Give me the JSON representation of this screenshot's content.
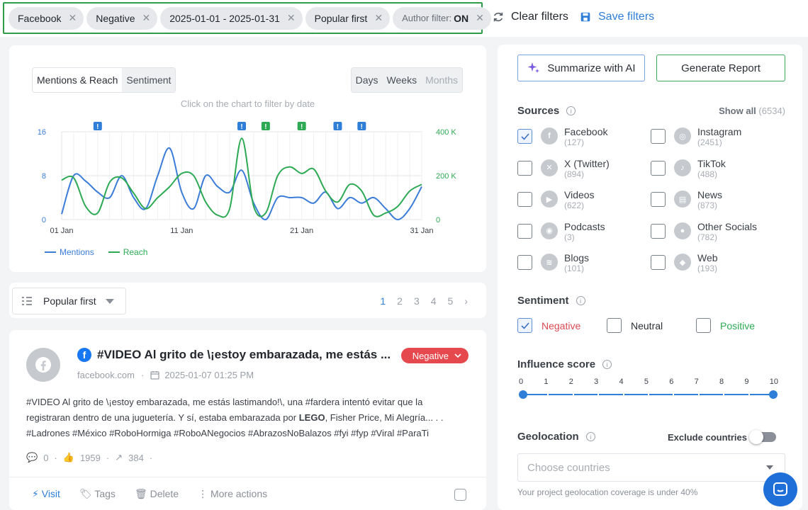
{
  "filters": {
    "chips": [
      {
        "label": "Facebook"
      },
      {
        "label": "Negative"
      },
      {
        "label": "2025-01-01 - 2025-01-31"
      },
      {
        "label": "Popular first"
      }
    ],
    "author_filter": {
      "label": "Author filter:",
      "value": "ON"
    },
    "clear_label": "Clear filters",
    "save_label": "Save filters"
  },
  "chart_panel": {
    "tabs_left": [
      "Mentions & Reach",
      "Sentiment"
    ],
    "tabs_right": [
      "Days",
      "Weeks",
      "Months"
    ],
    "hint": "Click on the chart to filter by date"
  },
  "chart_data": {
    "type": "line",
    "x": [
      "01 Jan",
      "02 Jan",
      "03 Jan",
      "04 Jan",
      "05 Jan",
      "06 Jan",
      "07 Jan",
      "08 Jan",
      "09 Jan",
      "10 Jan",
      "11 Jan",
      "12 Jan",
      "13 Jan",
      "14 Jan",
      "15 Jan",
      "16 Jan",
      "17 Jan",
      "18 Jan",
      "19 Jan",
      "20 Jan",
      "21 Jan",
      "22 Jan",
      "23 Jan",
      "24 Jan",
      "25 Jan",
      "26 Jan",
      "27 Jan",
      "28 Jan",
      "29 Jan",
      "30 Jan",
      "31 Jan"
    ],
    "xticks": [
      "01 Jan",
      "11 Jan",
      "21 Jan",
      "31 Jan"
    ],
    "left_axis": {
      "ticks": [
        "0",
        "8",
        "16"
      ],
      "range": [
        0,
        16
      ]
    },
    "right_axis": {
      "ticks": [
        "0",
        "200 K",
        "400 K"
      ],
      "range": [
        0,
        400000
      ]
    },
    "series": [
      {
        "name": "Mentions",
        "color": "#3b7dd8",
        "axis": "left",
        "values": [
          1,
          8,
          7,
          5,
          4,
          8,
          4,
          2,
          8,
          13,
          5,
          2,
          8,
          6,
          5,
          9,
          3,
          0,
          4,
          4,
          4,
          3,
          5,
          2,
          4,
          3,
          4,
          2,
          0,
          2,
          6
        ]
      },
      {
        "name": "Reach",
        "color": "#2eaa55",
        "axis": "right",
        "values": [
          180000,
          190000,
          60000,
          30000,
          170000,
          190000,
          120000,
          50000,
          100000,
          150000,
          210000,
          200000,
          80000,
          20000,
          50000,
          370000,
          60000,
          30000,
          200000,
          240000,
          210000,
          230000,
          130000,
          80000,
          160000,
          130000,
          20000,
          30000,
          60000,
          130000,
          160000
        ]
      }
    ],
    "markers_x": [
      "04 Jan",
      "16 Jan",
      "18 Jan",
      "21 Jan",
      "24 Jan",
      "26 Jan"
    ],
    "marker_colors": [
      "#2f7fd8",
      "#2f7fd8",
      "#2eaa55",
      "#2eaa55",
      "#2f7fd8",
      "#2f7fd8"
    ],
    "legend": [
      "Mentions",
      "Reach"
    ]
  },
  "sort": {
    "label": "Popular first",
    "pages": [
      "1",
      "2",
      "3",
      "4",
      "5"
    ],
    "current": "1"
  },
  "post": {
    "title": "#VIDEO Al grito de \\¡estoy embarazada, me estás ...",
    "sentiment": "Negative",
    "domain": "facebook.com",
    "date": "2025-01-07 01:25 PM",
    "body_1": "#VIDEO Al grito de \\¡estoy embarazada, me estás lastimando!\\, una #fardera intentó evitar que la",
    "body_2a": "registraran dentro de una juguetería. Y sí, estaba embarazada por ",
    "body_2b": "LEGO",
    "body_2c": ", Fisher Price, Mi Alegría... . .",
    "body_3": "#Ladrones #México #RoboHormiga #RoboANegocios #AbrazosNoBalazos #fyi #fyp #Viral #ParaTi",
    "comments": "0",
    "likes": "1959",
    "shares": "384",
    "actions": {
      "visit": "Visit",
      "tags": "Tags",
      "delete": "Delete",
      "more": "More actions"
    }
  },
  "sidebar": {
    "ai_label": "Summarize with AI",
    "report_label": "Generate Report",
    "sources_title": "Sources",
    "show_all": "Show all",
    "show_all_count": "(6534)",
    "sources": [
      {
        "name": "Facebook",
        "count": "(127)",
        "checked": true
      },
      {
        "name": "Instagram",
        "count": "(2451)",
        "checked": false
      },
      {
        "name": "X (Twitter)",
        "count": "(894)",
        "checked": false
      },
      {
        "name": "TikTok",
        "count": "(488)",
        "checked": false
      },
      {
        "name": "Videos",
        "count": "(622)",
        "checked": false
      },
      {
        "name": "News",
        "count": "(873)",
        "checked": false
      },
      {
        "name": "Podcasts",
        "count": "(3)",
        "checked": false
      },
      {
        "name": "Other Socials",
        "count": "(782)",
        "checked": false
      },
      {
        "name": "Blogs",
        "count": "(101)",
        "checked": false
      },
      {
        "name": "Web",
        "count": "(193)",
        "checked": false
      }
    ],
    "sentiment_title": "Sentiment",
    "sentiments": [
      {
        "label": "Negative",
        "color": "#d94a52",
        "checked": true
      },
      {
        "label": "Neutral",
        "color": "#3a3f47",
        "checked": false
      },
      {
        "label": "Positive",
        "color": "#2eaa55",
        "checked": false
      }
    ],
    "influence_title": "Influence score",
    "influence_ticks": [
      "0",
      "1",
      "2",
      "3",
      "4",
      "5",
      "6",
      "7",
      "8",
      "9",
      "10"
    ],
    "influence_range": [
      0,
      10
    ],
    "geo_title": "Geolocation",
    "exclude_label": "Exclude countries",
    "country_placeholder": "Choose countries",
    "geo_note": "Your project geolocation coverage is under 40%"
  }
}
